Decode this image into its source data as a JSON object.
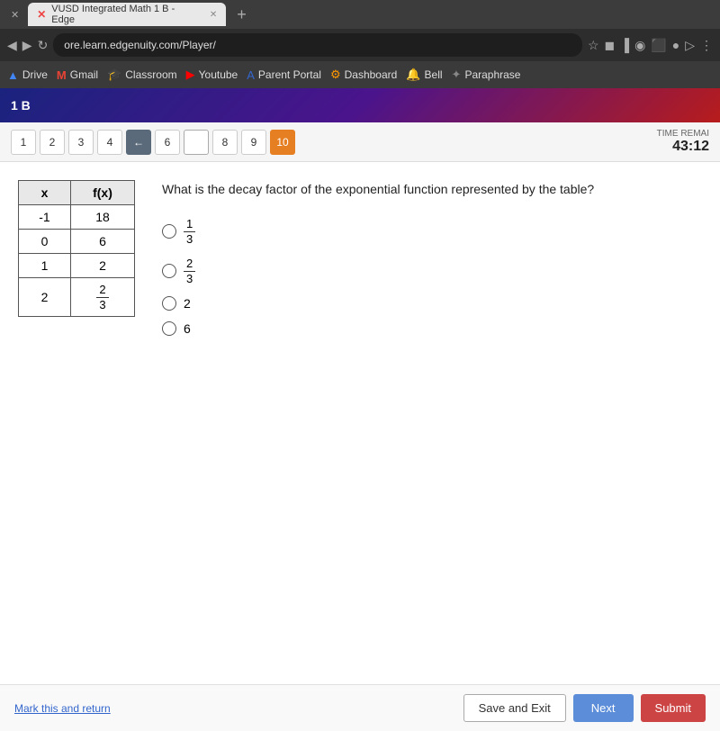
{
  "browser": {
    "tabs": [
      {
        "id": "tab1",
        "label": "x",
        "icon": "✕"
      },
      {
        "id": "tab2",
        "label": "VUSD Integrated Math 1 B - Edge",
        "icon": "✕",
        "active": true
      },
      {
        "id": "tab3",
        "label": "+",
        "icon": ""
      }
    ],
    "address": "ore.learn.edgenuity.com/Player/",
    "bookmarks": [
      {
        "id": "drive",
        "label": "Drive",
        "icon": "▲"
      },
      {
        "id": "gmail",
        "label": "Gmail",
        "icon": "M"
      },
      {
        "id": "classroom",
        "label": "Classroom",
        "icon": "🎓"
      },
      {
        "id": "youtube",
        "label": "Youtube",
        "icon": "▶"
      },
      {
        "id": "parent-portal",
        "label": "Parent Portal",
        "icon": "A"
      },
      {
        "id": "dashboard",
        "label": "Dashboard",
        "icon": "⚙"
      },
      {
        "id": "bell",
        "label": "Bell",
        "icon": "🔔"
      },
      {
        "id": "paraphrase",
        "label": "Paraphrase",
        "icon": "✦"
      }
    ]
  },
  "app": {
    "header_title": "1 B",
    "time_label": "TIME REMAI",
    "time_value": "43:12"
  },
  "question_nav": {
    "buttons": [
      {
        "label": "1",
        "state": "normal"
      },
      {
        "label": "2",
        "state": "normal"
      },
      {
        "label": "3",
        "state": "normal"
      },
      {
        "label": "4",
        "state": "normal"
      },
      {
        "label": "←",
        "state": "back"
      },
      {
        "label": "6",
        "state": "normal"
      },
      {
        "label": "",
        "state": "blank"
      },
      {
        "label": "8",
        "state": "normal"
      },
      {
        "label": "9",
        "state": "normal"
      },
      {
        "label": "10",
        "state": "active"
      }
    ]
  },
  "table": {
    "headers": [
      "x",
      "f(x)"
    ],
    "rows": [
      {
        "x": "-1",
        "fx": "18"
      },
      {
        "x": "0",
        "fx": "6"
      },
      {
        "x": "1",
        "fx": "2"
      },
      {
        "x": "2",
        "fx": "2/3"
      }
    ]
  },
  "question": {
    "text": "What is the decay factor of the exponential function represented by the table?",
    "options": [
      {
        "id": "opt1",
        "label_type": "fraction",
        "numerator": "1",
        "denominator": "3"
      },
      {
        "id": "opt2",
        "label_type": "fraction",
        "numerator": "2",
        "denominator": "3"
      },
      {
        "id": "opt3",
        "label_type": "text",
        "label": "2"
      },
      {
        "id": "opt4",
        "label_type": "text",
        "label": "6"
      }
    ]
  },
  "footer": {
    "mark_return_label": "Mark this and return",
    "save_exit_label": "Save and Exit",
    "next_label": "Next",
    "submit_label": "Submit"
  }
}
